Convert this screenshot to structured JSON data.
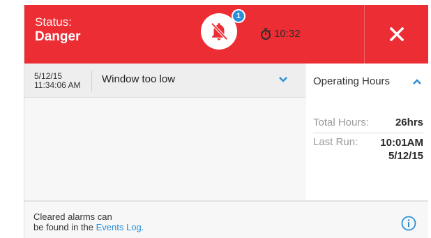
{
  "header": {
    "status_label": "Status:",
    "status_value": "Danger",
    "badge_count": "1",
    "timer_value": "10:32",
    "icons": {
      "bell": "bell-off-icon",
      "timer": "stopwatch-icon",
      "close": "close-icon"
    },
    "colors": {
      "danger": "#ed2d34",
      "badge": "#2b8fd8"
    }
  },
  "alarm": {
    "date": "5/12/15",
    "time": "11:34:06 AM",
    "message": "Window too low",
    "expand_icon": "chevron-down-icon"
  },
  "operating_hours": {
    "title": "Operating Hours",
    "collapse_icon": "chevron-up-icon",
    "total_hours_label": "Total Hours:",
    "total_hours_value": "26hrs",
    "last_run_label": "Last Run:",
    "last_run_time": "10:01AM",
    "last_run_date": "5/12/15"
  },
  "footer": {
    "line1": "Cleared alarms can",
    "line2_prefix": "be found in the ",
    "events_link": "Events Log.",
    "info_icon": "info-icon",
    "link_color": "#2b8fd8"
  }
}
